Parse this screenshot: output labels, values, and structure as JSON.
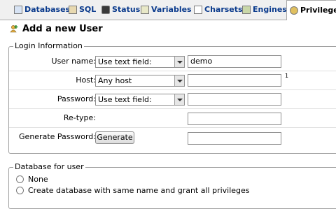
{
  "tabs": [
    {
      "label": "Databases",
      "icon": "databases-icon"
    },
    {
      "label": "SQL",
      "icon": "sql-icon"
    },
    {
      "label": "Status",
      "icon": "status-icon"
    },
    {
      "label": "Variables",
      "icon": "variables-icon"
    },
    {
      "label": "Charsets",
      "icon": "charsets-icon"
    },
    {
      "label": "Engines",
      "icon": "engines-icon"
    },
    {
      "label": "Privileges",
      "icon": "privileges-icon",
      "active": true
    }
  ],
  "page": {
    "title": "Add a new User"
  },
  "login": {
    "legend": "Login Information",
    "username_label": "User name:",
    "username_mode": "Use text field:",
    "username_value": "demo",
    "host_label": "Host:",
    "host_mode": "Any host",
    "host_value": "",
    "host_note": "1",
    "password_label": "Password:",
    "password_mode": "Use text field:",
    "password_value": "",
    "retype_label": "Re-type:",
    "retype_value": "",
    "generate_label": "Generate Password:",
    "generate_button": "Generate",
    "generate_value": ""
  },
  "database": {
    "legend": "Database for user",
    "options": [
      {
        "label": "None"
      },
      {
        "label": "Create database with same name and grant all privileges"
      }
    ]
  },
  "colors": {
    "tab_text": "#0a3a8c",
    "border": "#a0a0a0"
  }
}
